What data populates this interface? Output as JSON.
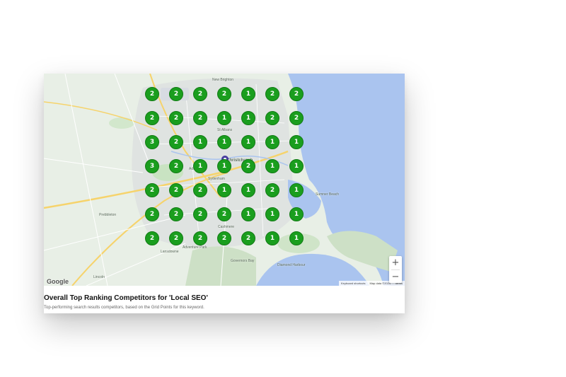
{
  "map": {
    "google_label": "Google",
    "attribution": {
      "keyboard": "Keyboard shortcuts",
      "mapdata": "Map data ©2024",
      "terms": "Terms"
    },
    "zoom_in": "+",
    "zoom_out": "−",
    "place_labels": [
      "New Brighton",
      "Christchurch",
      "Sydenham",
      "Addington",
      "Prebbleton",
      "Lincoln",
      "Lansdowne",
      "Governors Bay",
      "Diamond Harbour",
      "Sumner Beach",
      "Adventure Park",
      "St Albans",
      "Cashmere"
    ],
    "grid_rows": [
      [
        2,
        2,
        2,
        2,
        1,
        2,
        2
      ],
      [
        2,
        2,
        2,
        1,
        1,
        2,
        2
      ],
      [
        3,
        2,
        1,
        1,
        1,
        1,
        1
      ],
      [
        3,
        2,
        1,
        1,
        2,
        1,
        1
      ],
      [
        2,
        2,
        2,
        1,
        1,
        2,
        1
      ],
      [
        2,
        2,
        2,
        2,
        1,
        1,
        1
      ],
      [
        2,
        2,
        2,
        2,
        2,
        1,
        1
      ]
    ]
  },
  "title": "Overall Top Ranking Competitors for 'Local SEO'",
  "subtitle": "Top-performing search results competitors, based on the Grid Points for this keyword."
}
